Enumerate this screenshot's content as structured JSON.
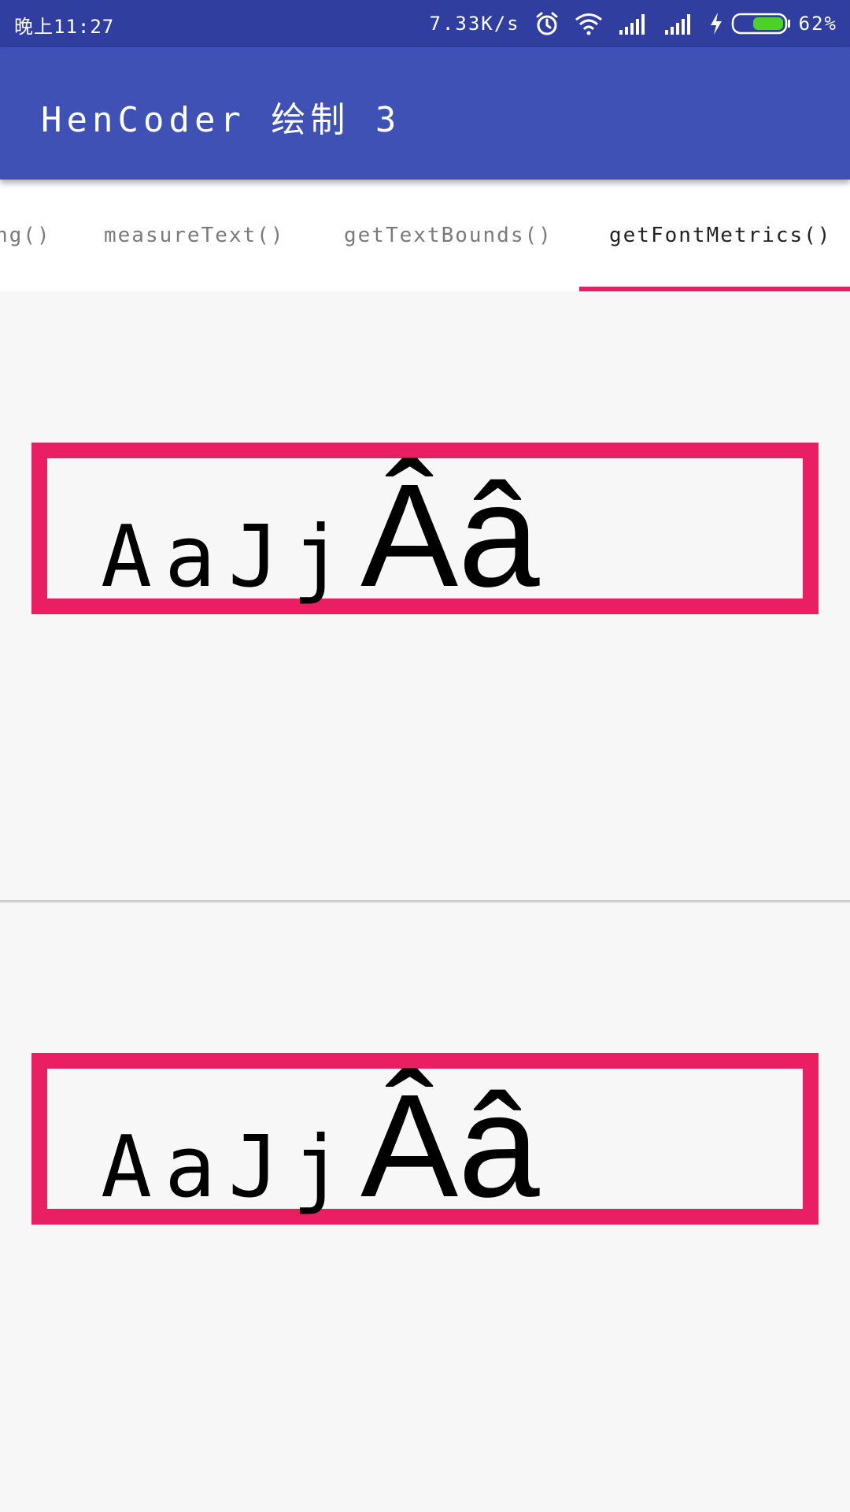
{
  "status_bar": {
    "time": "晚上11:27",
    "net_speed": "7.33K/s",
    "battery_percent": "62%",
    "battery_level": 0.62,
    "icons": [
      "alarm-icon",
      "wifi-icon",
      "signal-icon",
      "signal-icon",
      "charging-icon",
      "battery-icon"
    ]
  },
  "app_bar": {
    "title": "HenCoder 绘制 3"
  },
  "tabs": {
    "items": [
      {
        "label": "ng()"
      },
      {
        "label": "measureText()"
      },
      {
        "label": "getTextBounds()"
      },
      {
        "label": "getFontMetrics()"
      }
    ],
    "active_index": 3
  },
  "content": {
    "panels": [
      {
        "text_part1": "AaJj",
        "text_part2": "Ââ"
      },
      {
        "text_part1": "AaJj",
        "text_part2": "Ââ"
      }
    ]
  },
  "colors": {
    "status_bar": "#303f9f",
    "primary": "#3f51b5",
    "accent": "#e91e63",
    "background": "#f7f7f7"
  }
}
